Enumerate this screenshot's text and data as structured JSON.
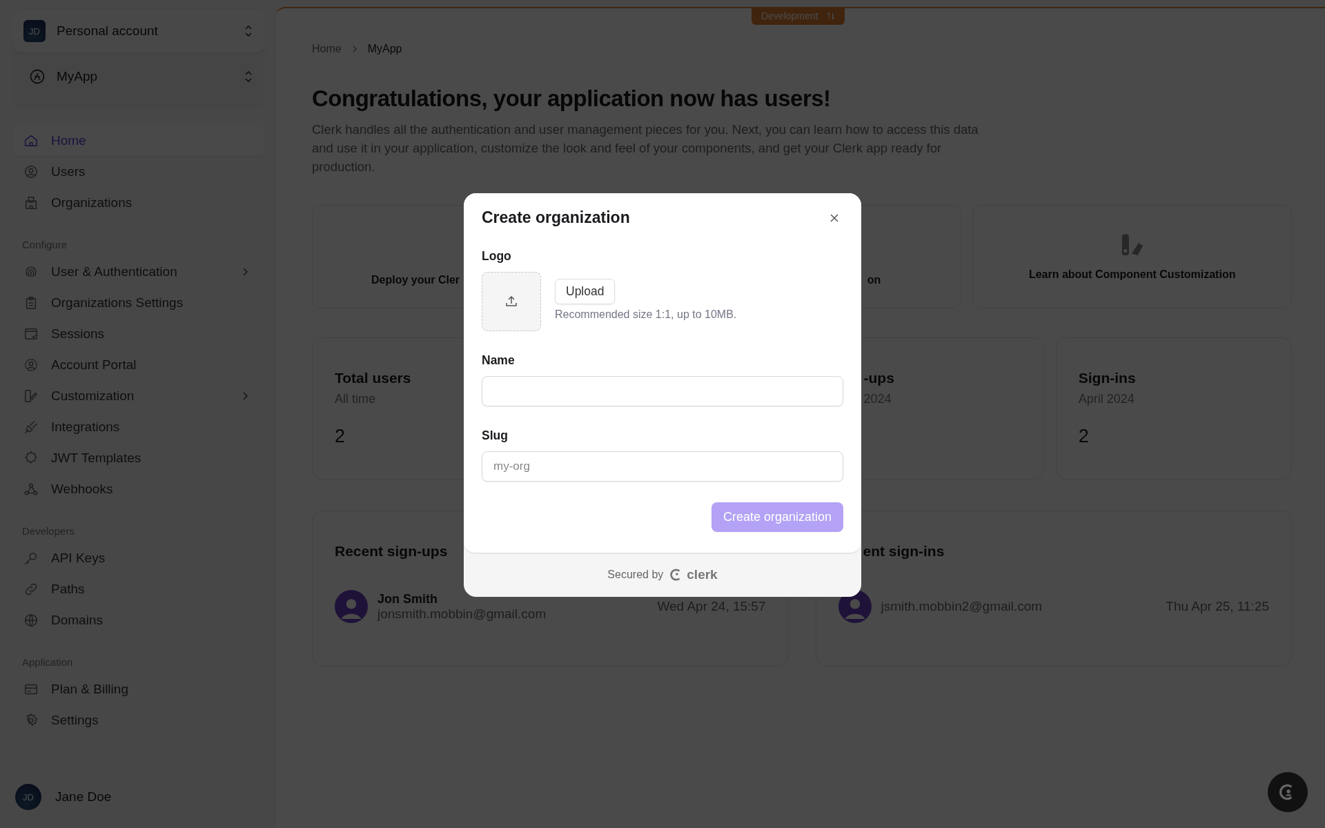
{
  "sidebar": {
    "account": {
      "initials": "JD",
      "label": "Personal account"
    },
    "app": {
      "label": "MyApp"
    },
    "sections": [
      {
        "items": [
          {
            "label": "Home",
            "selected": true,
            "has_submenu": false
          },
          {
            "label": "Users",
            "selected": false,
            "has_submenu": false
          },
          {
            "label": "Organizations",
            "selected": false,
            "has_submenu": false
          }
        ]
      },
      {
        "title": "Configure",
        "items": [
          {
            "label": "User & Authentication",
            "selected": false,
            "has_submenu": true
          },
          {
            "label": "Organizations Settings",
            "selected": false,
            "has_submenu": false
          },
          {
            "label": "Sessions",
            "selected": false,
            "has_submenu": false
          },
          {
            "label": "Account Portal",
            "selected": false,
            "has_submenu": false
          },
          {
            "label": "Customization",
            "selected": false,
            "has_submenu": true
          },
          {
            "label": "Integrations",
            "selected": false,
            "has_submenu": false
          },
          {
            "label": "JWT Templates",
            "selected": false,
            "has_submenu": false
          },
          {
            "label": "Webhooks",
            "selected": false,
            "has_submenu": false
          }
        ]
      },
      {
        "title": "Developers",
        "items": [
          {
            "label": "API Keys",
            "selected": false,
            "has_submenu": false
          },
          {
            "label": "Paths",
            "selected": false,
            "has_submenu": false
          },
          {
            "label": "Domains",
            "selected": false,
            "has_submenu": false
          }
        ]
      },
      {
        "title": "Application",
        "items": [
          {
            "label": "Plan & Billing",
            "selected": false,
            "has_submenu": false
          },
          {
            "label": "Settings",
            "selected": false,
            "has_submenu": false
          }
        ]
      }
    ],
    "user": {
      "initials": "JD",
      "name": "Jane Doe"
    }
  },
  "environment_badge": {
    "label": "Development"
  },
  "breadcrumb": [
    "Home",
    "MyApp"
  ],
  "heading": "Congratulations, your application now has users!",
  "intro": "Clerk handles all the authentication and user management pieces for you. Next, you can learn how to access this data and use it in your application, customize the look and feel of your components, and get your Clerk app ready for production.",
  "quick_links": [
    {
      "kind": "clipped-end",
      "label": "Deploy your Cler"
    },
    {
      "kind": "clipped-start",
      "label": "on"
    },
    {
      "kind": "full",
      "label": "Learn about Component Customization"
    }
  ],
  "stats": [
    {
      "kind": "full",
      "title": "Total users",
      "period": "All time",
      "value": "2"
    },
    {
      "kind": "clipped-start",
      "title": "-ups",
      "period": "2024"
    },
    {
      "kind": "full",
      "title": "Sign-ins",
      "period": "April 2024",
      "value": "2"
    }
  ],
  "recent": [
    {
      "kind": "full",
      "title": "Recent sign-ups",
      "rows": [
        {
          "name": "Jon Smith",
          "email": "jonsmith.mobbin@gmail.com",
          "time": "Wed Apr 24, 15:57"
        }
      ]
    },
    {
      "kind": "clipped-start",
      "title": "ent sign-ins",
      "rows": [
        {
          "email": "jsmith.mobbin2@gmail.com",
          "time": "Thu Apr 25, 11:25"
        }
      ]
    }
  ],
  "modal": {
    "title": "Create organization",
    "logo_label": "Logo",
    "upload_button": "Upload",
    "upload_hint": "Recommended size 1:1, up to 10MB.",
    "fields": [
      {
        "label": "Name"
      },
      {
        "label": "Slug",
        "placeholder": "my-org"
      }
    ],
    "submit": {
      "label": "Create organization",
      "disabled": true
    },
    "footer": {
      "text": "Secured by",
      "brand": "clerk"
    }
  }
}
